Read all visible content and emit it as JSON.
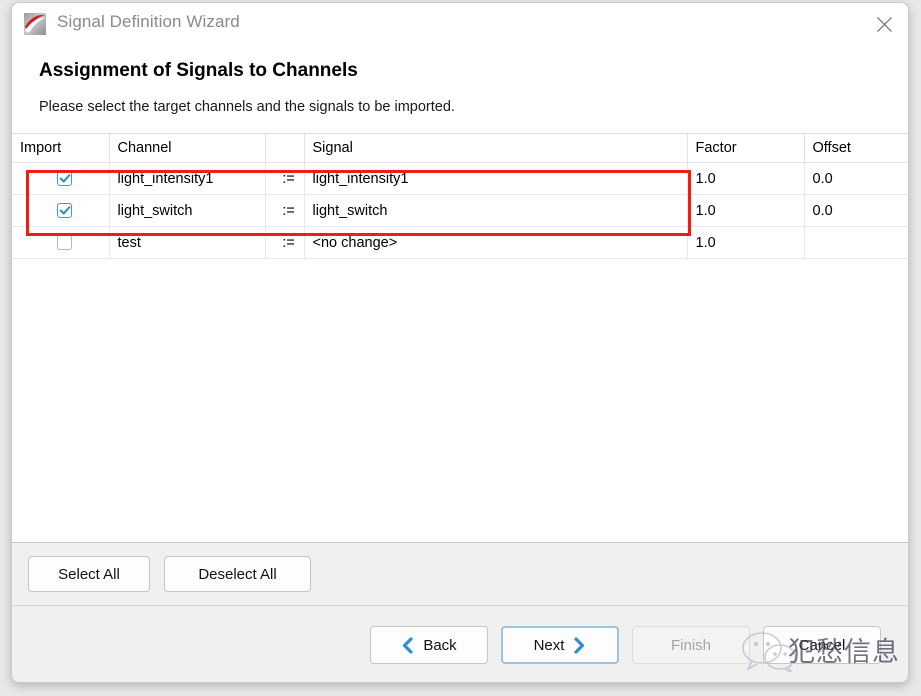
{
  "window": {
    "title": "Signal Definition Wizard",
    "app_icon": "wizard-logo-icon",
    "close_icon": "close-icon"
  },
  "header": {
    "page_title": "Assignment of Signals to Channels",
    "subtitle": "Please select the target channels and the signals to be imported."
  },
  "table": {
    "columns": [
      "Import",
      "Channel",
      "",
      "Signal",
      "Factor",
      "Offset"
    ],
    "assign_operator": ":=",
    "rows": [
      {
        "import_checked": true,
        "channel": "light_intensity1",
        "operator": ":=",
        "signal": "light_intensity1",
        "factor": "1.0",
        "offset": "0.0",
        "highlighted": true
      },
      {
        "import_checked": true,
        "channel": "light_switch",
        "operator": ":=",
        "signal": "light_switch",
        "factor": "1.0",
        "offset": "0.0",
        "highlighted": true
      },
      {
        "import_checked": false,
        "channel": "test",
        "operator": ":=",
        "signal": "<no change>",
        "factor": "1.0",
        "offset": "",
        "highlighted": false
      }
    ],
    "highlight_color": "#f01d13"
  },
  "select_bar": {
    "select_all": "Select All",
    "deselect_all": "Deselect All"
  },
  "footer": {
    "back": "Back",
    "next": "Next",
    "finish": "Finish",
    "cancel": "Cancel",
    "back_icon": "chevron-left-icon",
    "next_icon": "chevron-right-icon",
    "accent_color": "#2a8fd8",
    "focus_color": "#9cc4e4",
    "disabled_color": "#a6a6a6"
  },
  "watermark": {
    "text": "犯愁信息",
    "logo": "wechat-icon"
  }
}
